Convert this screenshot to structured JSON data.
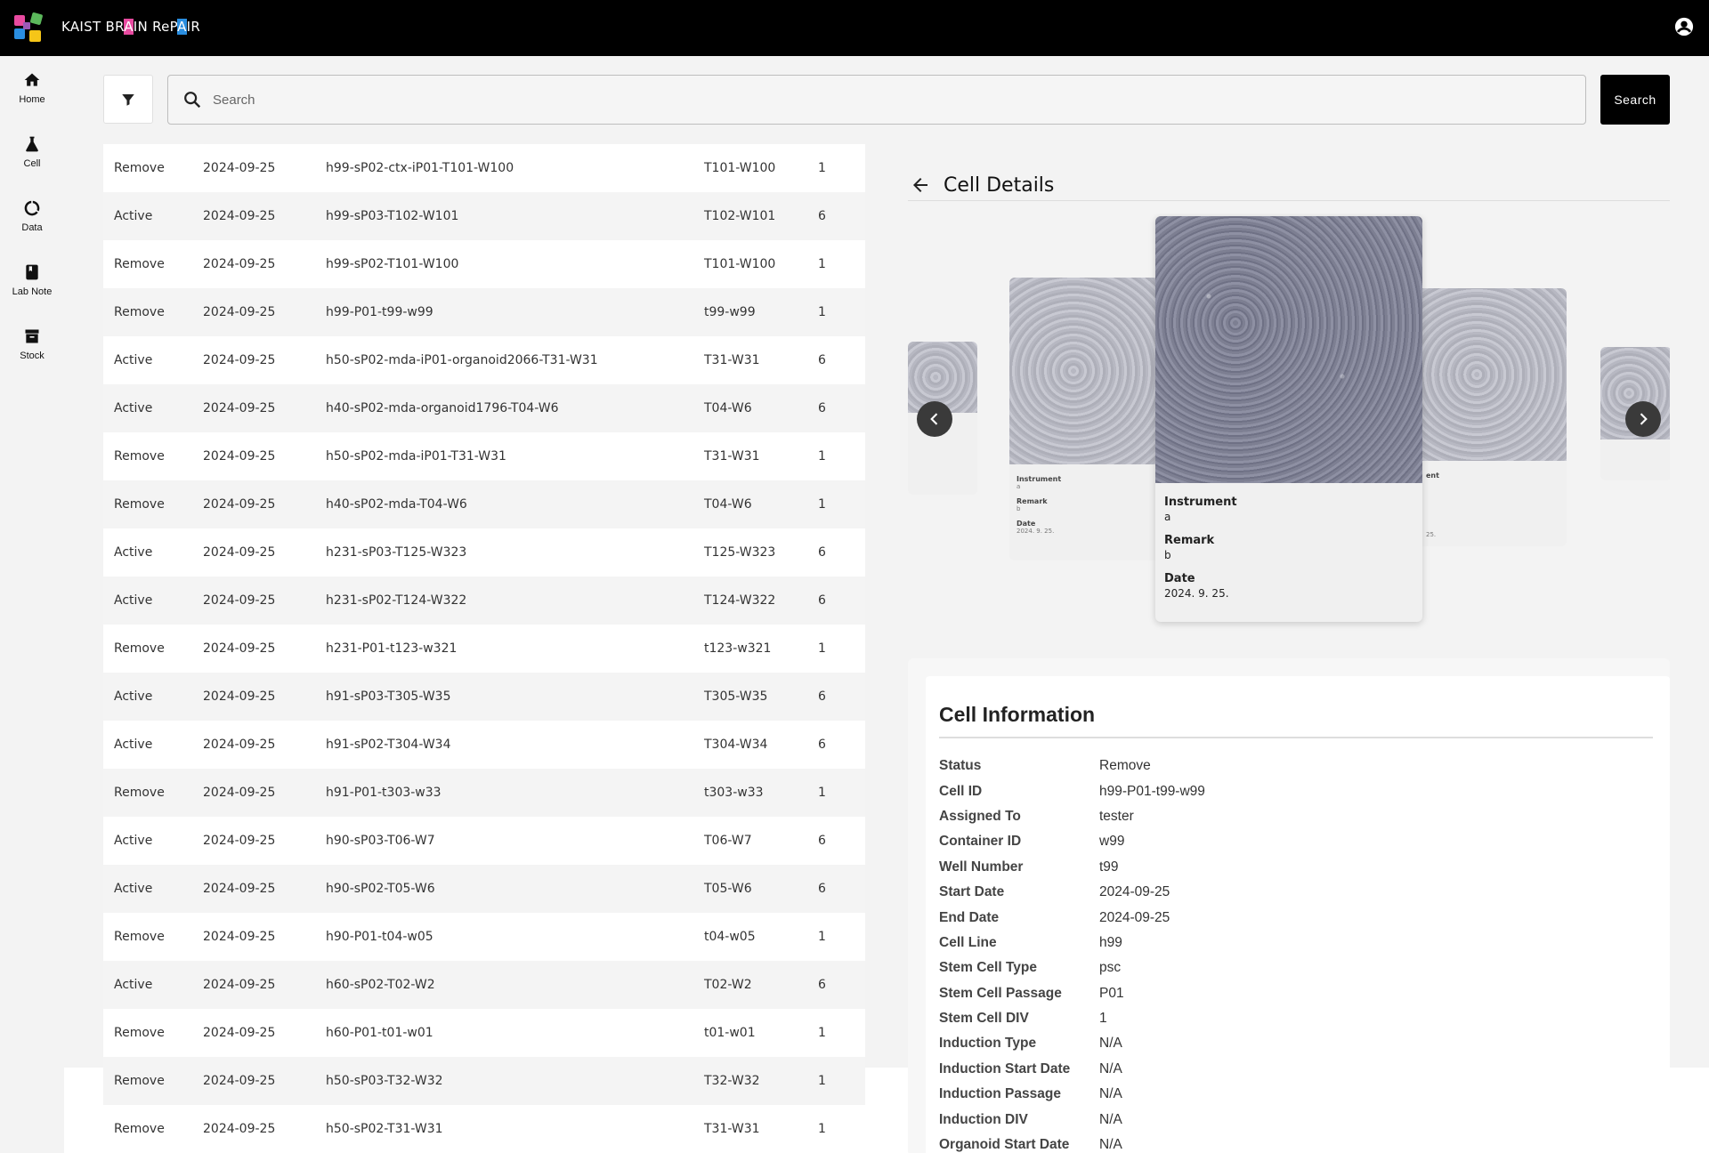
{
  "app": {
    "brand_prefix": "KAIST BR",
    "brand_a1": "A",
    "brand_mid": "IN ReP",
    "brand_a2": "A",
    "brand_suffix": "IR"
  },
  "sidebar": {
    "items": [
      {
        "label": "Home",
        "icon": "home-icon"
      },
      {
        "label": "Cell",
        "icon": "flask-icon"
      },
      {
        "label": "Data",
        "icon": "donut-chart-icon"
      },
      {
        "label": "Lab Note",
        "icon": "notebook-icon"
      },
      {
        "label": "Stock",
        "icon": "archive-box-icon"
      }
    ]
  },
  "search": {
    "placeholder": "Search",
    "button_label": "Search"
  },
  "table": {
    "rows": [
      {
        "status": "Remove",
        "date": "2024-09-25",
        "cell_id": "h99-sP02-ctx-iP01-T101-W100",
        "well": "T101-W100",
        "count": "1"
      },
      {
        "status": "Active",
        "date": "2024-09-25",
        "cell_id": "h99-sP03-T102-W101",
        "well": "T102-W101",
        "count": "6"
      },
      {
        "status": "Remove",
        "date": "2024-09-25",
        "cell_id": "h99-sP02-T101-W100",
        "well": "T101-W100",
        "count": "1"
      },
      {
        "status": "Remove",
        "date": "2024-09-25",
        "cell_id": "h99-P01-t99-w99",
        "well": "t99-w99",
        "count": "1"
      },
      {
        "status": "Active",
        "date": "2024-09-25",
        "cell_id": "h50-sP02-mda-iP01-organoid2066-T31-W31",
        "well": "T31-W31",
        "count": "6"
      },
      {
        "status": "Active",
        "date": "2024-09-25",
        "cell_id": "h40-sP02-mda-organoid1796-T04-W6",
        "well": "T04-W6",
        "count": "6"
      },
      {
        "status": "Remove",
        "date": "2024-09-25",
        "cell_id": "h50-sP02-mda-iP01-T31-W31",
        "well": "T31-W31",
        "count": "1"
      },
      {
        "status": "Remove",
        "date": "2024-09-25",
        "cell_id": "h40-sP02-mda-T04-W6",
        "well": "T04-W6",
        "count": "1"
      },
      {
        "status": "Active",
        "date": "2024-09-25",
        "cell_id": "h231-sP03-T125-W323",
        "well": "T125-W323",
        "count": "6"
      },
      {
        "status": "Active",
        "date": "2024-09-25",
        "cell_id": "h231-sP02-T124-W322",
        "well": "T124-W322",
        "count": "6"
      },
      {
        "status": "Remove",
        "date": "2024-09-25",
        "cell_id": "h231-P01-t123-w321",
        "well": "t123-w321",
        "count": "1"
      },
      {
        "status": "Active",
        "date": "2024-09-25",
        "cell_id": "h91-sP03-T305-W35",
        "well": "T305-W35",
        "count": "6"
      },
      {
        "status": "Active",
        "date": "2024-09-25",
        "cell_id": "h91-sP02-T304-W34",
        "well": "T304-W34",
        "count": "6"
      },
      {
        "status": "Remove",
        "date": "2024-09-25",
        "cell_id": "h91-P01-t303-w33",
        "well": "t303-w33",
        "count": "1"
      },
      {
        "status": "Active",
        "date": "2024-09-25",
        "cell_id": "h90-sP03-T06-W7",
        "well": "T06-W7",
        "count": "6"
      },
      {
        "status": "Active",
        "date": "2024-09-25",
        "cell_id": "h90-sP02-T05-W6",
        "well": "T05-W6",
        "count": "6"
      },
      {
        "status": "Remove",
        "date": "2024-09-25",
        "cell_id": "h90-P01-t04-w05",
        "well": "t04-w05",
        "count": "1"
      },
      {
        "status": "Active",
        "date": "2024-09-25",
        "cell_id": "h60-sP02-T02-W2",
        "well": "T02-W2",
        "count": "6"
      },
      {
        "status": "Remove",
        "date": "2024-09-25",
        "cell_id": "h60-P01-t01-w01",
        "well": "t01-w01",
        "count": "1"
      },
      {
        "status": "Remove",
        "date": "2024-09-25",
        "cell_id": "h50-sP03-T32-W32",
        "well": "T32-W32",
        "count": "1"
      },
      {
        "status": "Remove",
        "date": "2024-09-25",
        "cell_id": "h50-sP02-T31-W31",
        "well": "T31-W31",
        "count": "1"
      }
    ]
  },
  "details": {
    "title": "Cell Details",
    "carousel": {
      "center": {
        "instrument_label": "Instrument",
        "instrument": "a",
        "remark_label": "Remark",
        "remark": "b",
        "date_label": "Date",
        "date": "2024. 9. 25."
      },
      "left": {
        "instrument_label": "Instrument",
        "instrument": "a",
        "remark_label": "Remark",
        "remark": "b",
        "date_label": "Date",
        "date": "2024. 9. 25."
      },
      "right": {
        "instrument_label": "ent",
        "date": "25."
      }
    },
    "info": {
      "title": "Cell Information",
      "fields": [
        {
          "label": "Status",
          "value": "Remove"
        },
        {
          "label": "Cell ID",
          "value": "h99-P01-t99-w99"
        },
        {
          "label": "Assigned To",
          "value": "tester"
        },
        {
          "label": "Container ID",
          "value": "w99"
        },
        {
          "label": "Well Number",
          "value": "t99"
        },
        {
          "label": "Start Date",
          "value": "2024-09-25"
        },
        {
          "label": "End Date",
          "value": "2024-09-25"
        },
        {
          "label": "Cell Line",
          "value": "h99"
        },
        {
          "label": "Stem Cell Type",
          "value": "psc"
        },
        {
          "label": "Stem Cell Passage",
          "value": "P01"
        },
        {
          "label": "Stem Cell DIV",
          "value": "1"
        },
        {
          "label": "Induction Type",
          "value": "N/A"
        },
        {
          "label": "Induction Start Date",
          "value": "N/A"
        },
        {
          "label": "Induction Passage",
          "value": "N/A"
        },
        {
          "label": "Induction DIV",
          "value": "N/A"
        },
        {
          "label": "Organoid Start Date",
          "value": "N/A"
        }
      ]
    }
  },
  "colors": {
    "topbar": "#000000",
    "brand_pink": "#e84aa0",
    "brand_blue": "#2a8ee0",
    "search_button": "#000000"
  }
}
